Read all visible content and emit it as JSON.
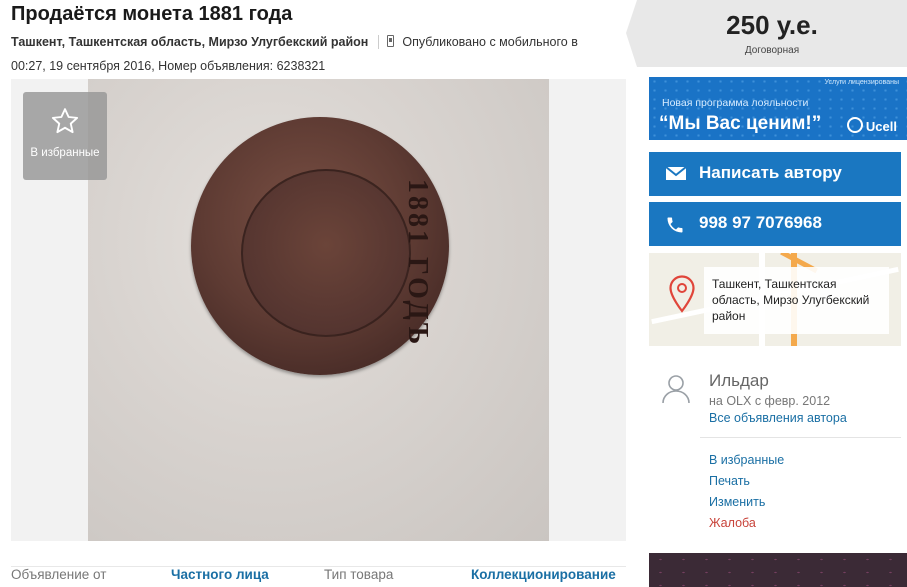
{
  "listing": {
    "title": "Продаётся монета 1881 года",
    "location": "Ташкент, Ташкентская область, Мирзо Улугбекский район",
    "published": "Опубликовано с мобильного в",
    "date_and_id": "00:27, 19 сентября 2016, Номер объявления: 6238321"
  },
  "photo": {
    "coin_inscription": "1881 ГОДЪ",
    "favorite_label": "В избранные",
    "favorite_icon": "star-outline-icon"
  },
  "details": [
    {
      "key": "Объявление от",
      "value": "Частного лица"
    },
    {
      "key": "Тип товара",
      "value": "Коллекционирование"
    }
  ],
  "sidebar": {
    "price": "250 у.е.",
    "price_note": "Договорная",
    "banner": {
      "top_note": "Услуги лицензированы",
      "line1": "Новая программа лояльности",
      "line2": "“Мы Вас ценим!”",
      "brand": "Ucell"
    },
    "write_author": "Написать автору",
    "write_icon": "envelope-icon",
    "phone": "998 97 7076968",
    "phone_icon": "phone-icon",
    "map_address": "Ташкент, Ташкентская область, Мирзо Улугбекский район",
    "map_pin_icon": "location-pin-icon",
    "author": {
      "name": "Ильдар",
      "since": "на OLX с февр. 2012",
      "all_ads": "Все объявления автора",
      "icon": "user-icon"
    },
    "actions": [
      "В избранные",
      "Печать",
      "Изменить",
      "Жалоба"
    ]
  },
  "colors": {
    "accent_blue": "#1a77c1",
    "link_blue": "#1a6fa4",
    "report_red": "#c8433a"
  }
}
